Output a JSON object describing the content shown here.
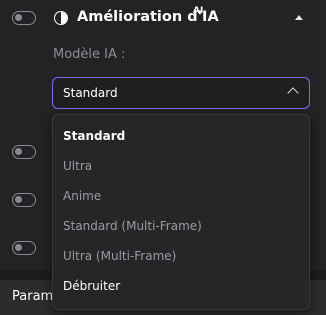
{
  "section": {
    "title": "Amélioration d'IA",
    "badge": "AI",
    "model_label": "Modèle IA :"
  },
  "select": {
    "value": "Standard"
  },
  "dropdown": {
    "options": [
      {
        "label": "Standard",
        "state": "selected"
      },
      {
        "label": "Ultra",
        "state": "muted"
      },
      {
        "label": "Anime",
        "state": "muted"
      },
      {
        "label": "Standard (Multi-Frame)",
        "state": "muted"
      },
      {
        "label": "Ultra (Multi-Frame)",
        "state": "muted"
      },
      {
        "label": "Débruiter",
        "state": "normal"
      }
    ]
  },
  "bottom": {
    "label": "Paramètres"
  },
  "colors": {
    "accent": "#7b6cf6",
    "background": "#232325"
  },
  "icons": [
    "toggle-icon",
    "half-circle-icon",
    "caret-up-icon",
    "chevron-up-icon"
  ]
}
